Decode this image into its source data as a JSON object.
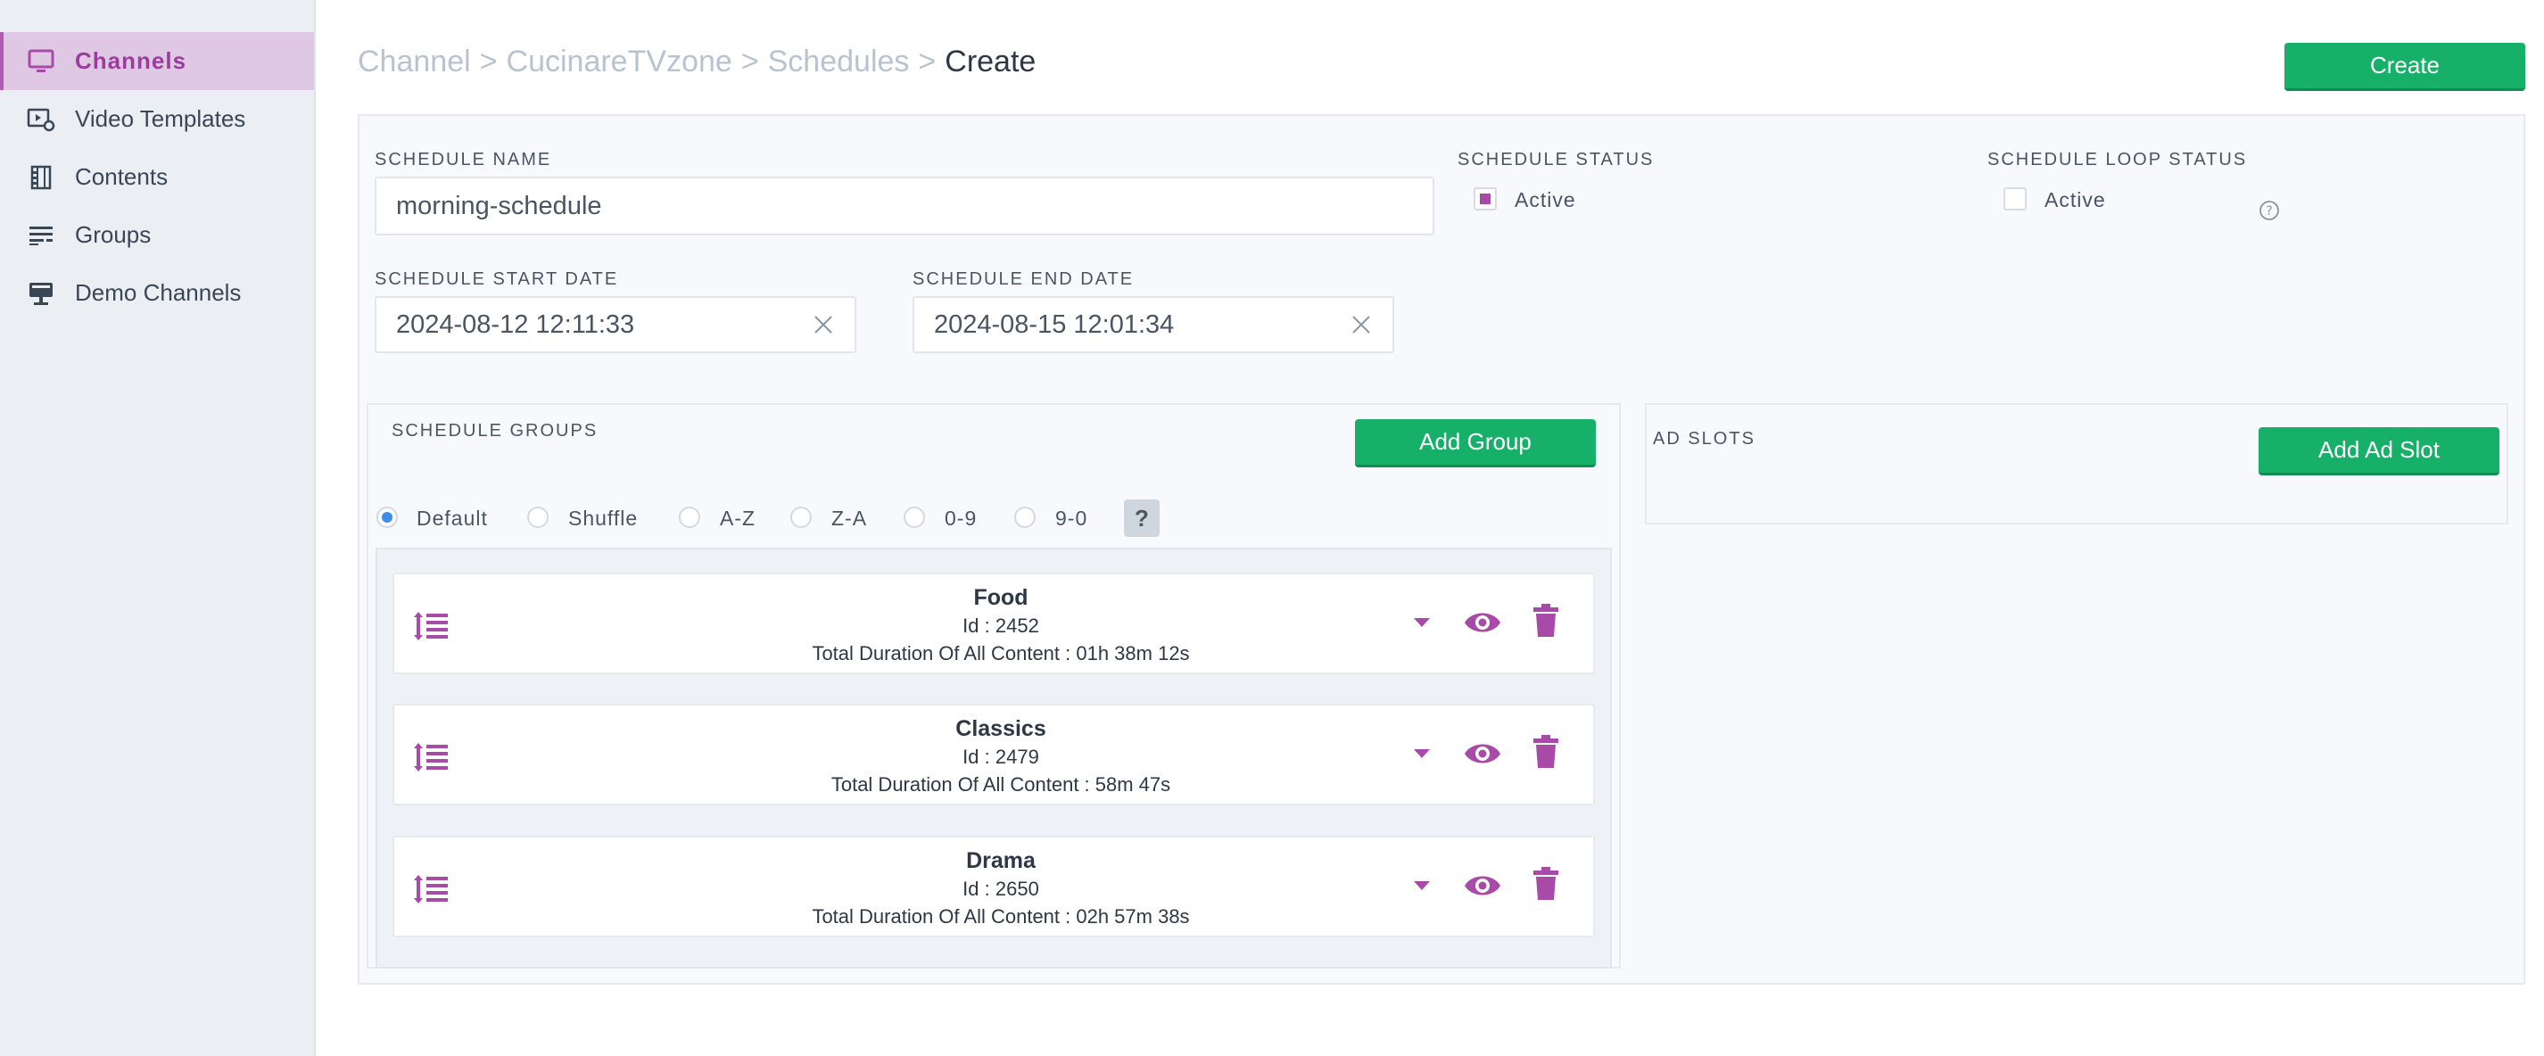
{
  "sidebar": {
    "items": [
      {
        "label": "Channels",
        "icon": "monitor-icon",
        "active": true
      },
      {
        "label": "Video Templates",
        "icon": "video-settings-icon",
        "active": false
      },
      {
        "label": "Contents",
        "icon": "film-icon",
        "active": false
      },
      {
        "label": "Groups",
        "icon": "list-icon",
        "active": false
      },
      {
        "label": "Demo Channels",
        "icon": "display-stand-icon",
        "active": false
      }
    ]
  },
  "header": {
    "breadcrumb": [
      "Channel",
      ">",
      "CucinareTVzone",
      ">",
      "Schedules",
      ">"
    ],
    "current": "Create",
    "create_label": "Create"
  },
  "form": {
    "schedule_name_label": "SCHEDULE NAME",
    "schedule_name_value": "morning-schedule",
    "schedule_status_label": "SCHEDULE STATUS",
    "schedule_status_option": "Active",
    "schedule_status_checked": true,
    "loop_status_label": "SCHEDULE LOOP STATUS",
    "loop_status_option": "Active",
    "loop_status_checked": false,
    "start_date_label": "SCHEDULE START DATE",
    "start_date_value": "2024-08-12 12:11:33",
    "end_date_label": "SCHEDULE END DATE",
    "end_date_value": "2024-08-15 12:01:34"
  },
  "groups": {
    "title": "SCHEDULE GROUPS",
    "add_label": "Add Group",
    "sort_options": [
      "Default",
      "Shuffle",
      "A-Z",
      "Z-A",
      "0-9",
      "9-0"
    ],
    "sort_selected": "Default",
    "help_label": "?",
    "items": [
      {
        "name": "Food",
        "id": "Id : 2452",
        "duration": "Total Duration Of All Content : 01h 38m 12s"
      },
      {
        "name": "Classics",
        "id": "Id : 2479",
        "duration": "Total Duration Of All Content : 58m 47s"
      },
      {
        "name": "Drama",
        "id": "Id : 2650",
        "duration": "Total Duration Of All Content : 02h 57m 38s"
      }
    ]
  },
  "ad_slots": {
    "title": "AD SLOTS",
    "add_label": "Add Ad Slot"
  },
  "colors": {
    "accent_purple": "#a84aa8",
    "primary_green": "#16b069",
    "radio_blue": "#3d8ee8"
  }
}
